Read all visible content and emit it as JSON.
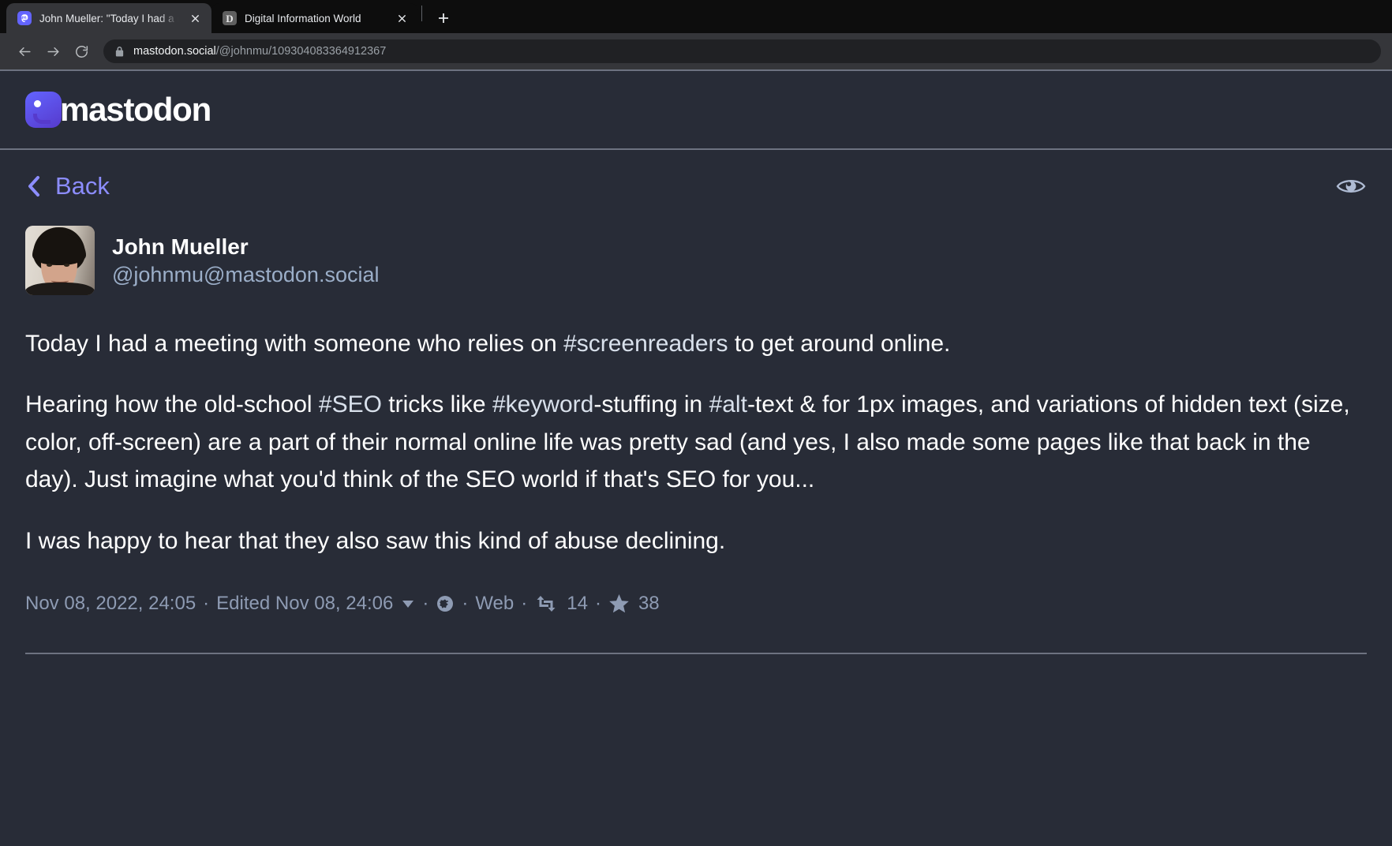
{
  "browser": {
    "tabs": [
      {
        "title": "John Mueller: \"Today I had a mee",
        "favicon": "mastodon-icon",
        "active": true,
        "close_label": "×"
      },
      {
        "title": "Digital Information World",
        "favicon": "letter-d-icon",
        "favicon_letter": "D",
        "active": false,
        "close_label": "×"
      }
    ],
    "new_tab_label": "+",
    "nav": {
      "back": "back-arrow-icon",
      "forward": "forward-arrow-icon",
      "reload": "reload-icon"
    },
    "omnibox": {
      "security_icon": "lock-icon",
      "host": "mastodon.social",
      "path": "/@johnmu/109304083364912367"
    }
  },
  "site": {
    "logo_word": "mastodon",
    "back_label": "Back",
    "visibility_toggle_icon": "eye-icon"
  },
  "post": {
    "account": {
      "display_name": "John Mueller",
      "handle": "@johnmu@mastodon.social",
      "avatar_alt": "avatar"
    },
    "paragraphs": [
      [
        {
          "t": "Today I had a meeting with someone who relies on ",
          "tag": false
        },
        {
          "t": "#screenreaders",
          "tag": true
        },
        {
          "t": " to get around online.",
          "tag": false
        }
      ],
      [
        {
          "t": "Hearing how the old-school ",
          "tag": false
        },
        {
          "t": "#SEO",
          "tag": true
        },
        {
          "t": " tricks like ",
          "tag": false
        },
        {
          "t": "#keyword",
          "tag": true
        },
        {
          "t": "-stuffing in ",
          "tag": false
        },
        {
          "t": "#alt",
          "tag": true
        },
        {
          "t": "-text & for 1px images, and variations of hidden text (size, color, off-screen) are a part of their normal online life was pretty sad (and yes, I also made some pages like that back in the day). Just imagine what you'd think of the SEO world if that's SEO for you...",
          "tag": false
        }
      ],
      [
        {
          "t": "I was happy to hear that they also saw this kind of abuse declining.",
          "tag": false
        }
      ]
    ],
    "meta": {
      "timestamp": "Nov 08, 2022, 24:05",
      "separator": "·",
      "edited": "Edited Nov 08, 24:06",
      "edited_caret_icon": "chevron-down-icon",
      "visibility_icon": "globe-icon",
      "source": "Web",
      "boost_icon": "boost-icon",
      "boost_count": "14",
      "favourite_icon": "star-icon",
      "favourite_count": "38"
    }
  },
  "colors": {
    "page_bg": "#282c37",
    "accent_link": "#8c8dff",
    "muted_text": "#9baec8",
    "brand_purple": "#6364ff"
  }
}
